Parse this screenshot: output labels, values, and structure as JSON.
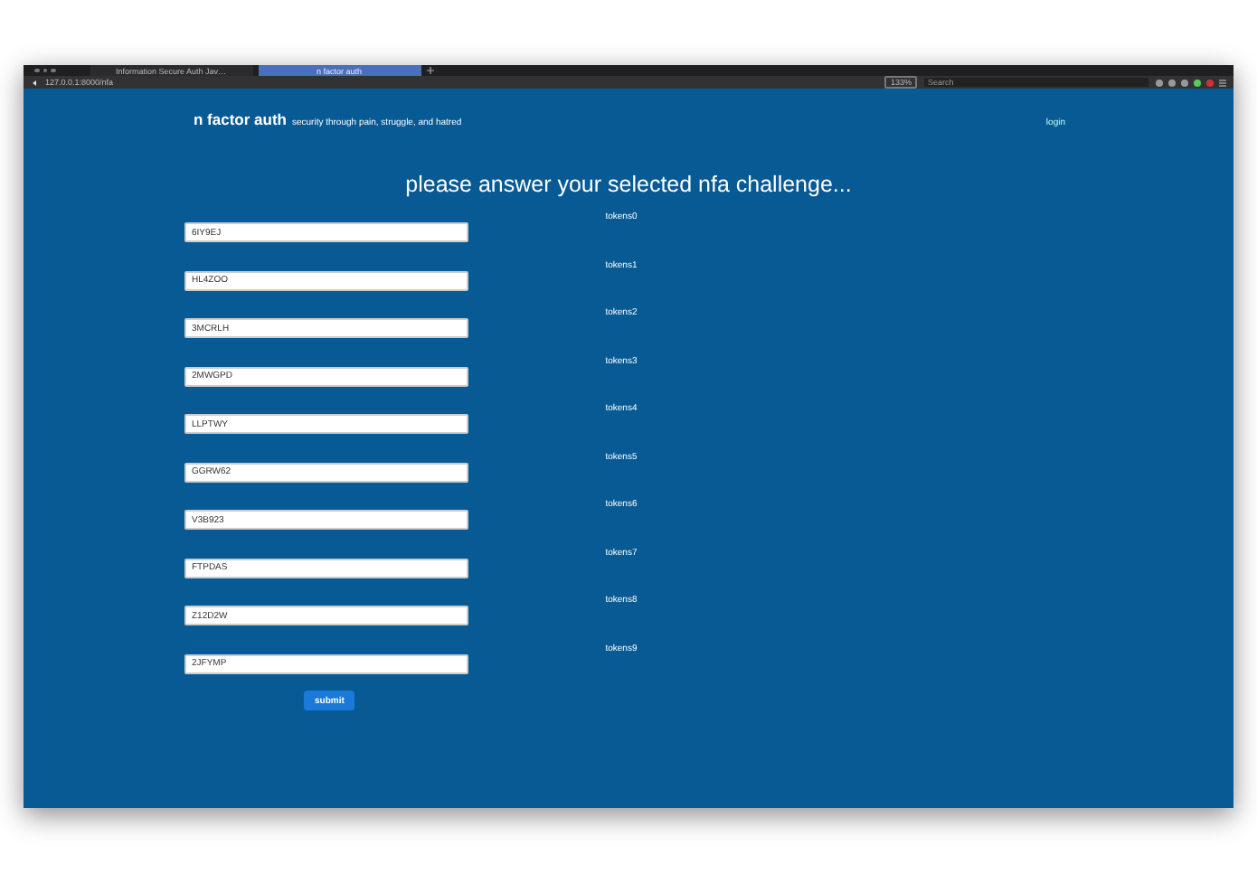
{
  "browser": {
    "tabs": [
      {
        "label": "Information Secure Auth Jav…",
        "selected": false
      },
      {
        "label": "n factor auth",
        "selected": true
      }
    ],
    "address": "127.0.0.1:8000/nfa",
    "zoom": "133%",
    "search": {
      "placeholder": "Search"
    }
  },
  "header": {
    "brand": "n factor auth",
    "tagline": "security through pain, struggle, and hatred",
    "login": "login"
  },
  "heading": "please answer your selected nfa challenge...",
  "challenges": [
    {
      "token": "tokens0",
      "value": "6IY9EJ"
    },
    {
      "token": "tokens1",
      "value": "HL4ZOO"
    },
    {
      "token": "tokens2",
      "value": "3MCRLH"
    },
    {
      "token": "tokens3",
      "value": "2MWGPD"
    },
    {
      "token": "tokens4",
      "value": "LLPTWY"
    },
    {
      "token": "tokens5",
      "value": "GGRW62"
    },
    {
      "token": "tokens6",
      "value": "V3B923"
    },
    {
      "token": "tokens7",
      "value": "FTPDAS"
    },
    {
      "token": "tokens8",
      "value": "Z12D2W"
    },
    {
      "token": "tokens9",
      "value": "2JFYMP"
    }
  ],
  "submit": "submit"
}
